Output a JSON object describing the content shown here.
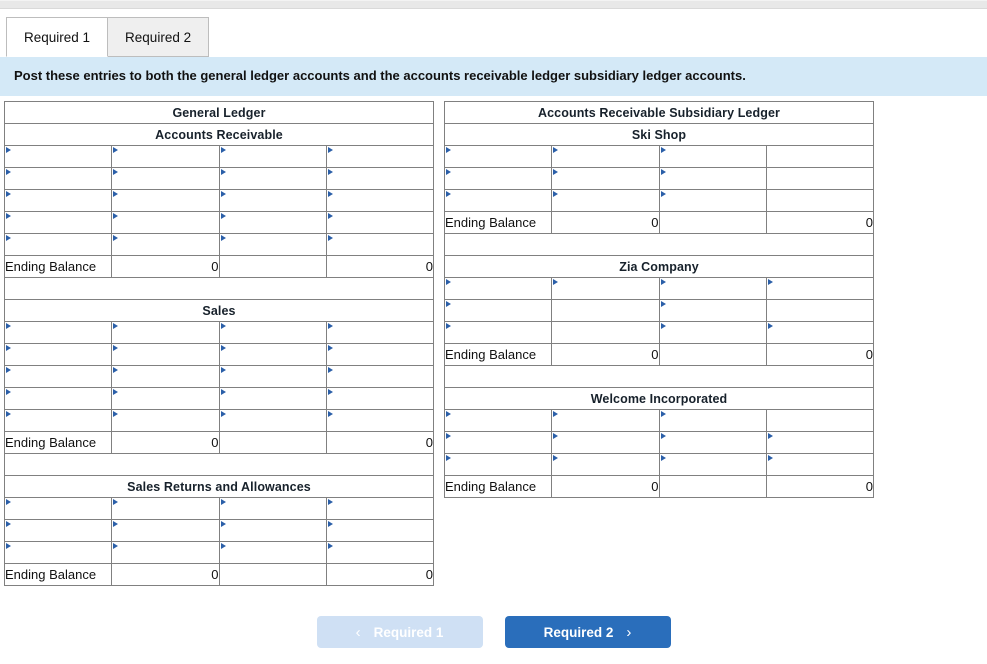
{
  "tabs": [
    {
      "label": "Required 1",
      "active": true
    },
    {
      "label": "Required 2",
      "active": false
    }
  ],
  "instruction": "Post these entries to both the general ledger accounts and the accounts receivable ledger subsidiary ledger accounts.",
  "colors": {
    "band_blue": "#7cace8",
    "instruction_blue": "#d4e9f7",
    "input_border_blue": "#4a7ebb",
    "marker_blue": "#2b5fa8",
    "button_active_blue": "#2a6ebb",
    "button_disabled_blue": "#cfe0f4"
  },
  "ending_balance_label": "Ending Balance",
  "ending_balance_value": "0",
  "left_ledger": {
    "title": "General Ledger",
    "blocks": [
      {
        "title": "Accounts Receivable",
        "rows": [
          [
            true,
            true,
            true,
            true
          ],
          [
            true,
            true,
            true,
            true
          ],
          [
            true,
            true,
            true,
            true
          ],
          [
            true,
            true,
            true,
            true
          ],
          [
            true,
            true,
            true,
            true
          ]
        ],
        "ending_balance": [
          "Ending Balance",
          "0",
          "",
          "0"
        ],
        "spacer": "short"
      },
      {
        "title": "Sales",
        "rows": [
          [
            true,
            true,
            true,
            true
          ],
          [
            true,
            true,
            true,
            true
          ],
          [
            true,
            true,
            true,
            true
          ],
          [
            true,
            true,
            true,
            true
          ],
          [
            true,
            true,
            true,
            true
          ]
        ],
        "ending_balance": [
          "Ending Balance",
          "0",
          "",
          "0"
        ],
        "spacer": "short"
      },
      {
        "title": "Sales Returns and Allowances",
        "rows": [
          [
            true,
            true,
            true,
            true
          ],
          [
            true,
            true,
            true,
            true
          ],
          [
            true,
            true,
            true,
            true
          ]
        ],
        "ending_balance": [
          "Ending Balance",
          "0",
          "",
          "0"
        ],
        "spacer": "none"
      }
    ]
  },
  "right_ledger": {
    "title": "Accounts Receivable Subsidiary Ledger",
    "blocks": [
      {
        "title": "Ski Shop",
        "rows": [
          [
            true,
            true,
            true,
            false
          ],
          [
            true,
            true,
            true,
            false
          ],
          [
            true,
            true,
            true,
            false
          ]
        ],
        "ending_balance": [
          "Ending Balance",
          "0",
          "",
          "0"
        ],
        "spacer": "tall"
      },
      {
        "title": "Zia Company",
        "rows": [
          [
            true,
            true,
            true,
            true
          ],
          [
            true,
            false,
            true,
            false
          ],
          [
            true,
            false,
            true,
            true
          ]
        ],
        "ending_balance": [
          "Ending Balance",
          "0",
          "",
          "0"
        ],
        "spacer": "tall"
      },
      {
        "title": "Welcome Incorporated",
        "rows": [
          [
            true,
            true,
            true,
            false
          ],
          [
            true,
            true,
            true,
            true
          ],
          [
            true,
            true,
            true,
            true
          ]
        ],
        "ending_balance": [
          "Ending Balance",
          "0",
          "",
          "0"
        ],
        "spacer": "none"
      }
    ]
  },
  "footer": {
    "prev": {
      "label": "Required 1",
      "chevron": "‹",
      "disabled": true
    },
    "next": {
      "label": "Required 2",
      "chevron": "›",
      "disabled": false
    }
  }
}
